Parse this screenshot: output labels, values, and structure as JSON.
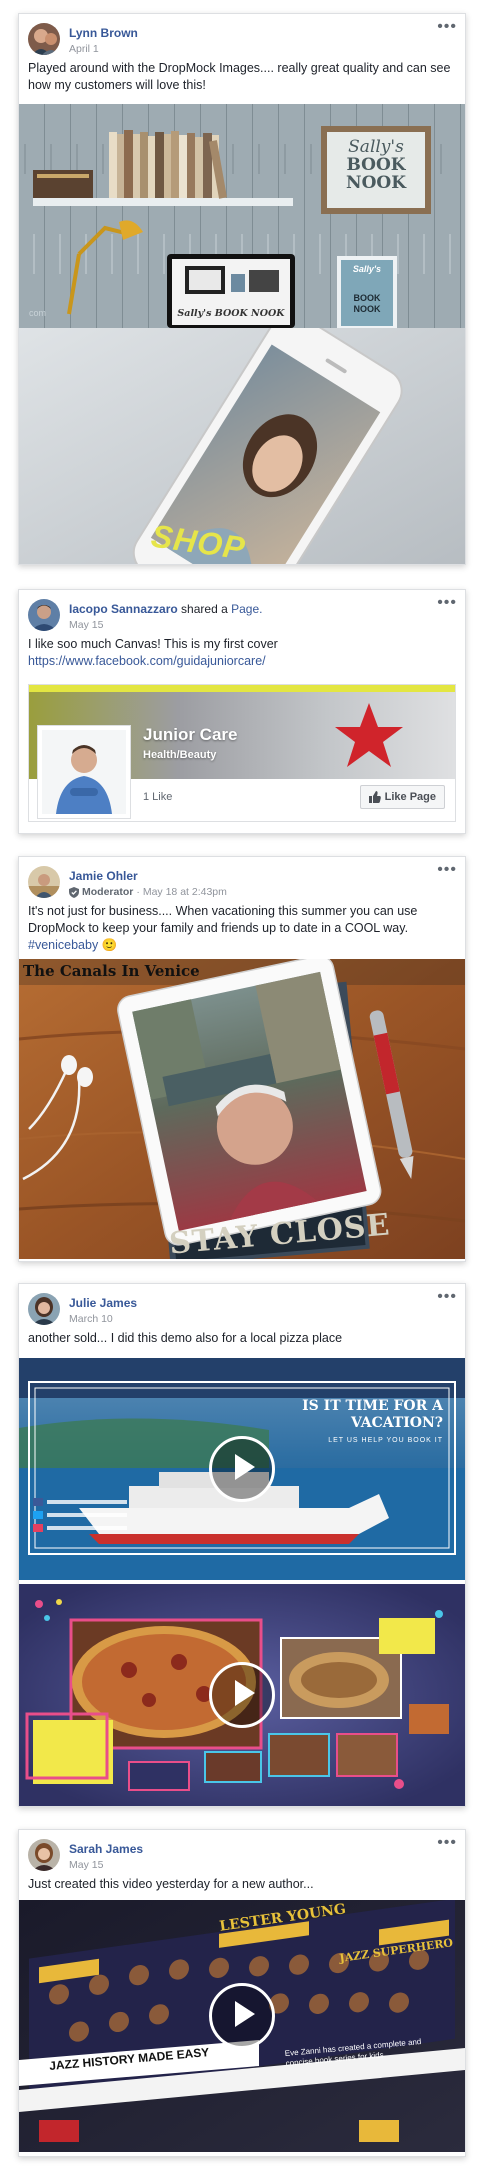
{
  "posts": [
    {
      "author": "Lynn Brown",
      "date": "April 1",
      "text": "Played around with the DropMock Images.... really great quality and can see how my customers will love this!",
      "image1": {
        "sign_line1": "Sally's",
        "sign_line2": "BOOK",
        "sign_line3": "NOOK",
        "screen_caption": "Sally's BOOK NOOK",
        "book_line1": "Sally's",
        "book_line2": "BOOK",
        "book_line3": "NOOK"
      },
      "image2": {
        "overlay_text": "SHOP"
      }
    },
    {
      "author": "Iacopo Sannazzaro",
      "action": "shared a",
      "action_link": "Page.",
      "date": "May 15",
      "text": "I like soo much Canvas! This is my first cover",
      "link": "https://www.facebook.com/guidajuniorcare/",
      "page_card": {
        "name": "Junior Care",
        "category": "Health/Beauty",
        "likes": "1 Like",
        "like_button": "Like Page"
      }
    },
    {
      "author": "Jamie Ohler",
      "badge": "Moderator",
      "date": "May 18 at 2:43pm",
      "text": "It's not just for business.... When vacationing this summer you can use DropMock to keep your family and friends up to date in a COOL way.",
      "hashtag": "#venicebaby",
      "emoji": "🙂",
      "image": {
        "title": "The Canals In Venice",
        "book_text": "STAY CLOSE"
      }
    },
    {
      "author": "Julie James",
      "date": "March 10",
      "text": "another sold... I did this demo also for a local pizza place",
      "video1": {
        "headline_1": "IS IT TIME FOR A",
        "headline_2": "VACATION?",
        "subline": "LET US HELP YOU BOOK IT"
      }
    },
    {
      "author": "Sarah James",
      "date": "May 15",
      "text": "Just created this video yesterday for a new author...",
      "video": {
        "banner": "JAZZ HISTORY MADE EASY",
        "caption": "Eve Zanni has created a complete and concise book series for kids.",
        "title_1": "LESTER YOUNG",
        "title_2": "JAZZ SUPERHERO"
      }
    }
  ],
  "icons": {
    "more": "more-options-icon",
    "play": "play-icon",
    "like": "thumbs-up-icon",
    "verified": "shield-badge-icon"
  },
  "colors": {
    "name_blue": "#385898",
    "meta_grey": "#90949c",
    "border": "#dddfe2"
  }
}
